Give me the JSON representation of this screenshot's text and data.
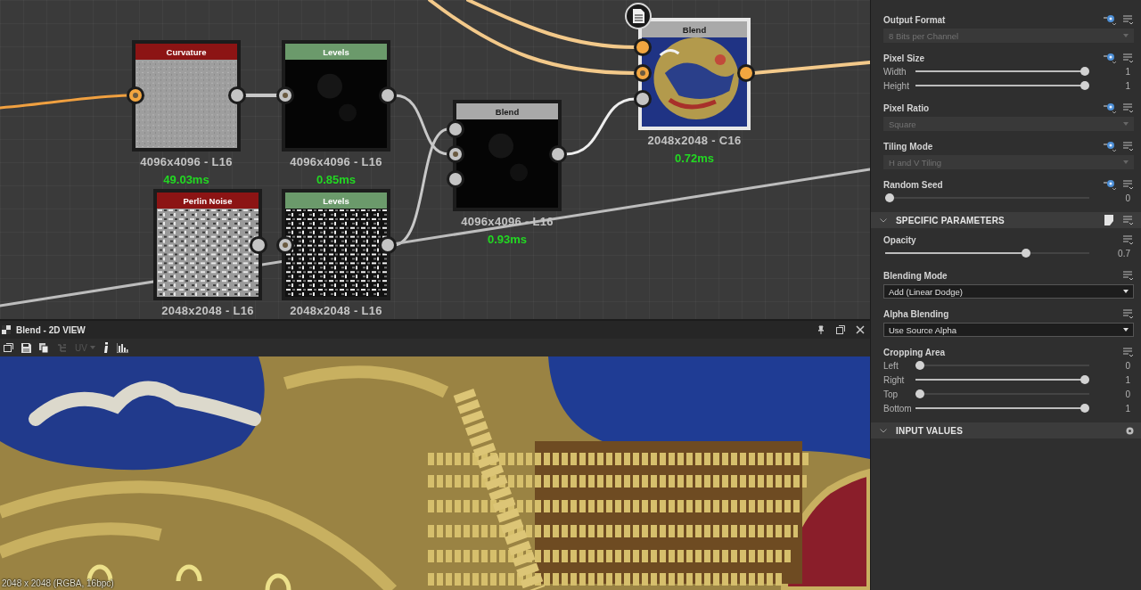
{
  "graph": {
    "nodes": [
      {
        "title": "Curvature",
        "color": "#8c1414",
        "resolution": "4096x4096 - L16",
        "time": "49.03ms",
        "selected": false
      },
      {
        "title": "Levels",
        "color": "#6b9a6b",
        "resolution": "4096x4096 - L16",
        "time": "0.85ms",
        "selected": false
      },
      {
        "title": "Perlin Noise",
        "color": "#8c1414",
        "resolution": "2048x2048 - L16",
        "selected": false
      },
      {
        "title": "Levels",
        "color": "#6b9a6b",
        "resolution": "2048x2048 - L16",
        "selected": false
      },
      {
        "title": "Blend",
        "color": "#a9a9a9",
        "resolution": "4096x4096 - L16",
        "time": "0.93ms",
        "selected": false
      },
      {
        "title": "Blend",
        "color": "#a9a9a9",
        "resolution": "2048x2048 - C16",
        "time": "0.72ms",
        "selected": true
      }
    ]
  },
  "view": {
    "title": "Blend - 2D VIEW",
    "uv_label": "UV",
    "uv_disabled": true,
    "status": "2048 x 2048 (RGBA, 16bpc)"
  },
  "properties": {
    "params": [
      {
        "kind": "dropdown",
        "label": "Output Format",
        "value": "8 Bits per Channel",
        "disabled": true,
        "exposable": true
      },
      {
        "kind": "sliders",
        "label": "Pixel Size",
        "exposable": true,
        "rows": [
          {
            "label": "Width",
            "level": 1,
            "reading": "1"
          },
          {
            "label": "Height",
            "level": 1,
            "reading": "1"
          }
        ]
      },
      {
        "kind": "dropdown",
        "label": "Pixel Ratio",
        "value": "Square",
        "disabled": true,
        "exposable": true
      },
      {
        "kind": "dropdown",
        "label": "Tiling Mode",
        "value": "H and V Tiling",
        "disabled": true,
        "exposable": true
      },
      {
        "kind": "sliders",
        "label": "Random Seed",
        "exposable": true,
        "rows": [
          {
            "level": 0,
            "reading": "0"
          }
        ]
      }
    ],
    "sections": [
      {
        "title": "SPECIFIC PARAMETERS",
        "params": [
          {
            "kind": "sliders",
            "label": "Opacity",
            "exposable": false,
            "rows": [
              {
                "level": 0.7,
                "reading": "0.7"
              }
            ]
          },
          {
            "kind": "dropdown",
            "label": "Blending Mode",
            "value": "Add (Linear Dodge)",
            "disabled": false,
            "exposable": false
          },
          {
            "kind": "dropdown",
            "label": "Alpha Blending",
            "value": "Use Source Alpha",
            "disabled": false,
            "exposable": false
          },
          {
            "kind": "sliders",
            "label": "Cropping Area",
            "exposable": false,
            "rows": [
              {
                "label": "Left",
                "level": 0,
                "reading": "0"
              },
              {
                "label": "Right",
                "level": 1,
                "reading": "1"
              },
              {
                "label": "Top",
                "level": 0,
                "reading": "0"
              },
              {
                "label": "Bottom",
                "level": 1,
                "reading": "1"
              }
            ]
          }
        ]
      },
      {
        "title": "INPUT VALUES"
      }
    ]
  }
}
